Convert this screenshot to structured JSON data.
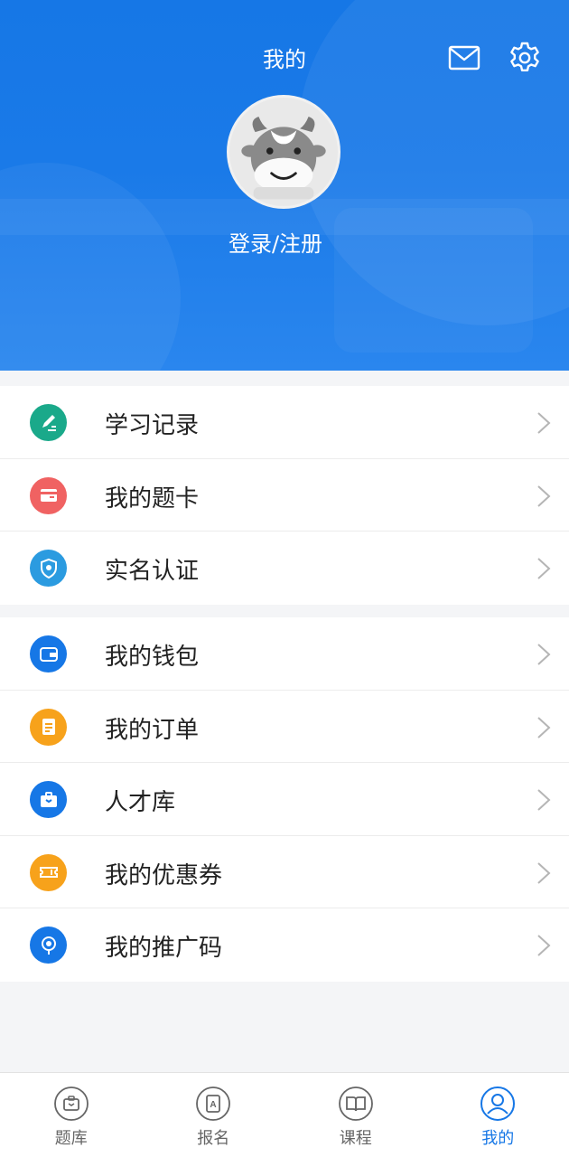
{
  "header": {
    "title": "我的",
    "login_label": "登录/注册"
  },
  "menu_groups": [
    {
      "items": [
        {
          "label": "学习记录",
          "icon": "pencil-edit-icon",
          "color": "#1aa98a"
        },
        {
          "label": "我的题卡",
          "icon": "card-icon",
          "color": "#f06262"
        },
        {
          "label": "实名认证",
          "icon": "shield-verify-icon",
          "color": "#2b9be0"
        }
      ]
    },
    {
      "items": [
        {
          "label": "我的钱包",
          "icon": "wallet-icon",
          "color": "#1677e6"
        },
        {
          "label": "我的订单",
          "icon": "order-list-icon",
          "color": "#f7a21b"
        },
        {
          "label": "人才库",
          "icon": "briefcase-icon",
          "color": "#1677e6"
        },
        {
          "label": "我的优惠券",
          "icon": "coupon-icon",
          "color": "#f7a21b"
        },
        {
          "label": "我的推广码",
          "icon": "promo-code-icon",
          "color": "#1677e6"
        }
      ]
    }
  ],
  "tabs": [
    {
      "label": "题库",
      "icon": "question-bank-icon",
      "active": false
    },
    {
      "label": "报名",
      "icon": "register-icon",
      "active": false
    },
    {
      "label": "课程",
      "icon": "course-book-icon",
      "active": false
    },
    {
      "label": "我的",
      "icon": "profile-icon",
      "active": true
    }
  ],
  "colors": {
    "brand": "#1677e6",
    "inactive_tab": "#666666",
    "background": "#f4f5f7"
  }
}
